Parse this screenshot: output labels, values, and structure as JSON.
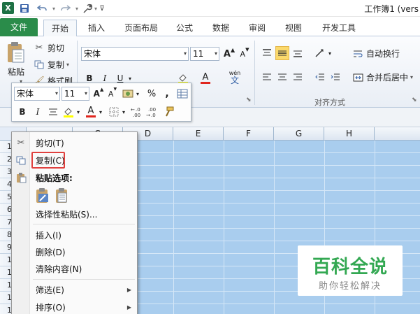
{
  "window": {
    "title": "工作簿1 (vers",
    "app_logo": "X"
  },
  "quick_access": {
    "save_icon": "floppy-disk-icon",
    "undo_icon": "undo-arrow-icon",
    "redo_icon": "redo-arrow-icon",
    "tools_icon": "wrench-icon",
    "customize_icon": "chevron-down-icon"
  },
  "tabs": [
    {
      "label": "文件"
    },
    {
      "label": "开始"
    },
    {
      "label": "插入"
    },
    {
      "label": "页面布局"
    },
    {
      "label": "公式"
    },
    {
      "label": "数据"
    },
    {
      "label": "审阅"
    },
    {
      "label": "视图"
    },
    {
      "label": "开发工具"
    }
  ],
  "ribbon": {
    "clipboard": {
      "paste_label": "粘贴",
      "cut_label": "剪切",
      "copy_label": "复制",
      "format_painter_label": "格式刷"
    },
    "font": {
      "font_name": "宋体",
      "font_size": "11",
      "grow_label": "A",
      "shrink_label": "A",
      "bold": "B",
      "italic": "I",
      "underline": "U",
      "wen": "wén",
      "wen_char": "文"
    },
    "alignment": {
      "wrap_text_label": "自动换行",
      "merge_center_label": "合并后居中",
      "group_label": "对齐方式"
    }
  },
  "mini_toolbar": {
    "font_name": "宋体",
    "font_size": "11",
    "percent": "%",
    "comma": ",",
    "bold": "B",
    "italic": "I",
    "font_color_letter": "A"
  },
  "columns": [
    "C",
    "D",
    "E",
    "F",
    "G",
    "H"
  ],
  "rows": [
    "1",
    "2",
    "3",
    "4",
    "5",
    "6",
    "7",
    "8",
    "9",
    "10",
    "11",
    "12",
    "13",
    "14"
  ],
  "context_menu": {
    "items": [
      {
        "label": "剪切(T)"
      },
      {
        "label": "复制(C)"
      },
      {
        "label": "粘贴选项:"
      },
      {
        "label": "选择性粘贴(S)..."
      },
      {
        "label": "插入(I)"
      },
      {
        "label": "删除(D)"
      },
      {
        "label": "清除内容(N)"
      },
      {
        "label": "筛选(E)"
      },
      {
        "label": "排序(O)"
      }
    ]
  },
  "watermark": {
    "title": "百科全说",
    "subtitle": "助你轻松解决"
  },
  "colors": {
    "file_tab": "#2a8c4a",
    "selection": "#a9cdee",
    "highlight": "#e0413f",
    "watermark_green": "#33a852"
  }
}
